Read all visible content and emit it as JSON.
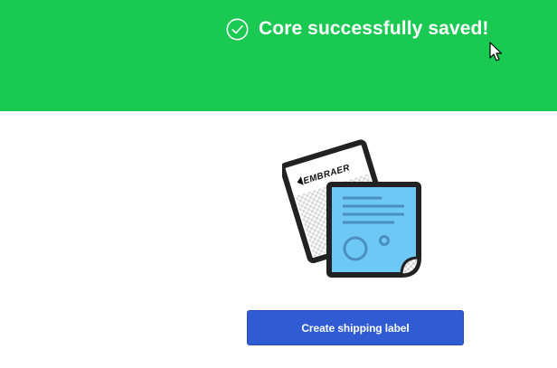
{
  "banner": {
    "message": "Core successfully saved!",
    "background_color": "#1ac952",
    "icon": "check-circle-icon"
  },
  "illustration": {
    "brand_text": "EMBRAER",
    "icon": "shipping-label-documents-illustration",
    "doc_color": "#6ec8f5"
  },
  "actions": {
    "create_label_text": "Create shipping label",
    "button_color": "#2f5bd3"
  },
  "cursor": {
    "icon": "mouse-pointer-icon"
  }
}
